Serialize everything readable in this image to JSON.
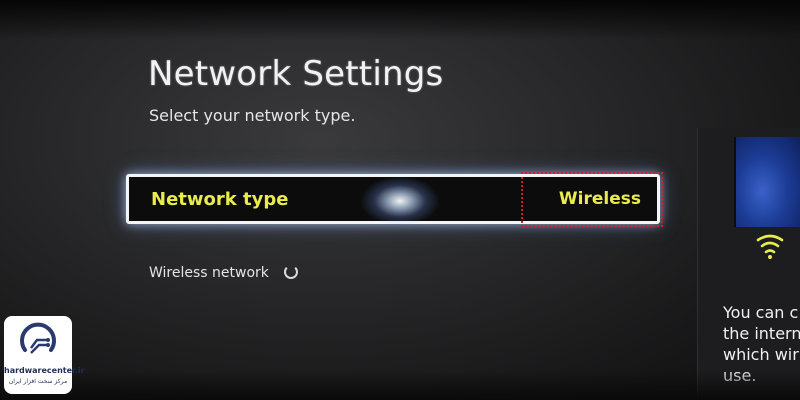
{
  "screen": {
    "title": "Network Settings",
    "subtitle": "Select your network type."
  },
  "network_type_row": {
    "label": "Network type",
    "value": "Wireless"
  },
  "wireless_network": {
    "label": "Wireless network",
    "status_icon": "loading-spinner-icon"
  },
  "help_panel": {
    "text_lines": [
      "You can c",
      "the intern",
      "which wir",
      "use."
    ],
    "illustration_icon": "wifi-signal-icon"
  },
  "watermark": {
    "site": "hardwarecenter.ir",
    "tagline": "مرکز سخت افزار ایران"
  },
  "colors": {
    "accent_yellow": "#e9ec4a",
    "focus_border": "#f5f5f5",
    "highlight_red": "#d81e24"
  }
}
